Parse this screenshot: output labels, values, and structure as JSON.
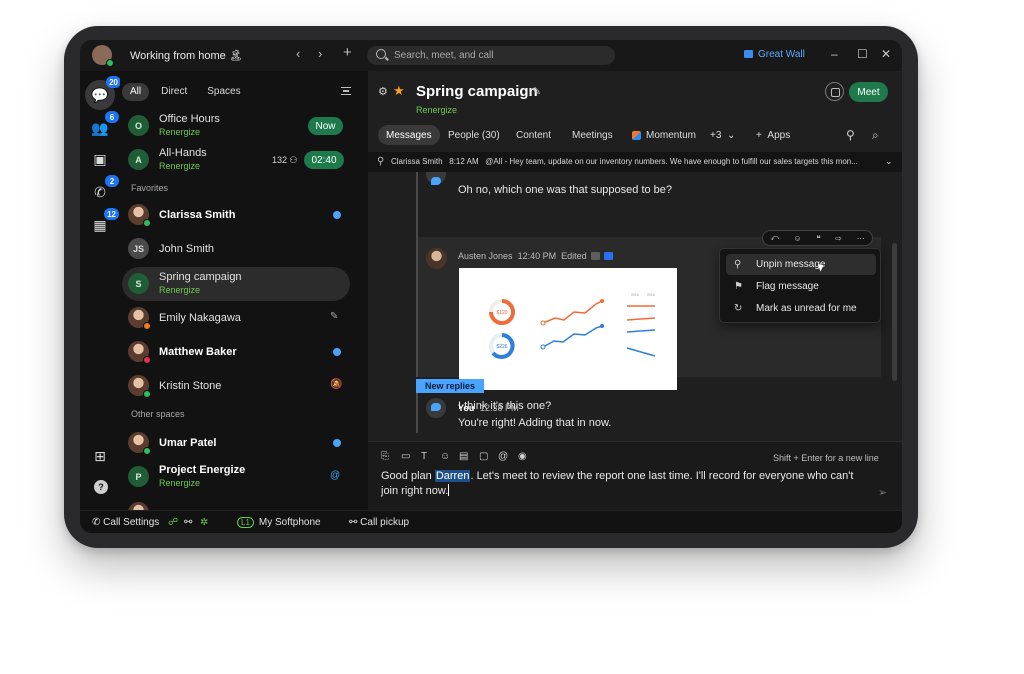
{
  "titlebar": {
    "status": "Working from home 🏝",
    "search_placeholder": "Search, meet, and call",
    "workspace": "Great Wall"
  },
  "rail": {
    "badges": [
      "20",
      "6",
      "2",
      "12"
    ]
  },
  "list": {
    "filters": [
      "All",
      "Direct",
      "Spaces"
    ],
    "rows": [
      {
        "name": "Office Hours",
        "sub": "Renergize",
        "initial": "O",
        "pill": "Now"
      },
      {
        "name": "All-Hands",
        "sub": "Renergize",
        "initial": "A",
        "count": "132",
        "pill": "02:40"
      },
      {
        "name": "Clarissa Smith"
      },
      {
        "name": "John Smith",
        "initial": "JS"
      },
      {
        "name": "Spring campaign",
        "sub": "Renergize",
        "initial": "S"
      },
      {
        "name": "Emily Nakagawa"
      },
      {
        "name": "Matthew Baker"
      },
      {
        "name": "Kristin Stone"
      },
      {
        "name": "Umar Patel"
      },
      {
        "name": "Project Energize",
        "sub": "Renergize",
        "initial": "P"
      }
    ],
    "section_favorites": "Favorites",
    "section_other": "Other spaces"
  },
  "chat": {
    "title": "Spring campaign",
    "subtitle": "Renergize",
    "meet": "Meet",
    "tabs": [
      "Messages",
      "People (30)",
      "Content",
      "Meetings",
      "Momentum",
      "+3",
      "Apps"
    ],
    "pinned": {
      "author": "Clarissa Smith",
      "time": "8:12 AM",
      "text": "@All - Hey team, update on our inventory numbers. We have enough to fulfill our sales targets this mon..."
    },
    "msg1": "Oh no, which one was that supposed to be?",
    "msg2": {
      "author": "Austen Jones",
      "time": "12:40 PM",
      "edited": "Edited",
      "text": "I think it's this one?"
    },
    "menu": [
      "Unpin message",
      "Flag message",
      "Mark as unread for me"
    ],
    "new_replies": "New replies",
    "reply": {
      "author": "You",
      "time": "12:38 PM",
      "text": "You're right! Adding that in now."
    },
    "composer": {
      "hint": "Shift + Enter for a new line",
      "before": "Good plan ",
      "mention": "Darren",
      "after": ". Let's meet to review the report one last time. I'll record for everyone who can't join right now."
    }
  },
  "chart_thumb": {
    "donut_labels": [
      "$120",
      "$226"
    ],
    "legend": [
      "2015",
      "2016"
    ]
  },
  "bottombar": {
    "call_settings": "Call Settings",
    "l1": "L1",
    "softphone": "My Softphone",
    "pickup": "Call pickup"
  },
  "colors": {
    "accent_green": "#1e7a4a",
    "space_green": "#6ec94f",
    "unread_blue": "#4aa3ff",
    "badge_blue": "#1d74f5",
    "star": "#f4a21e"
  }
}
